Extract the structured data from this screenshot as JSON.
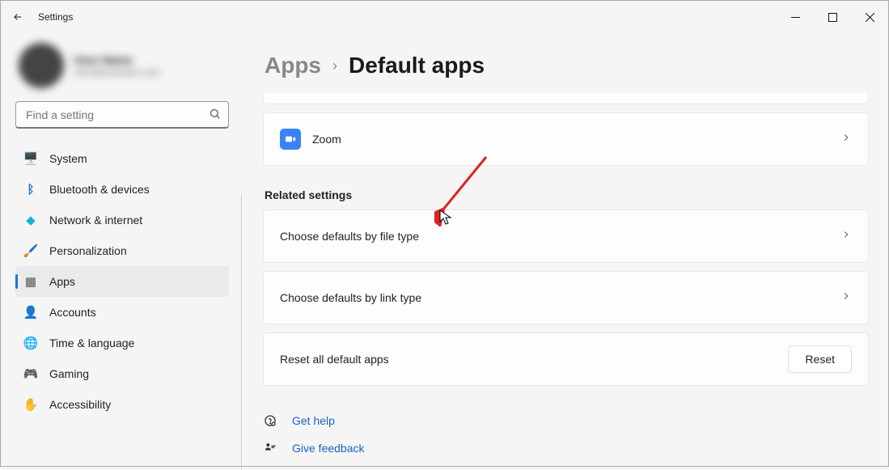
{
  "window": {
    "title": "Settings"
  },
  "search": {
    "placeholder": "Find a setting"
  },
  "profile": {
    "name": "User Name",
    "email": "user@example.com"
  },
  "nav": {
    "items": [
      {
        "icon": "🖥️",
        "label": "System"
      },
      {
        "icon": "B",
        "label": "Bluetooth & devices",
        "iconColor": "#1976d2"
      },
      {
        "icon": "◆",
        "label": "Network & internet",
        "iconColor": "#1bb1d4"
      },
      {
        "icon": "🖌️",
        "label": "Personalization"
      },
      {
        "icon": "▦",
        "label": "Apps",
        "selected": true
      },
      {
        "icon": "👤",
        "label": "Accounts",
        "iconColor": "#2fae4f"
      },
      {
        "icon": "🌐",
        "label": "Time & language"
      },
      {
        "icon": "🎮",
        "label": "Gaming"
      },
      {
        "icon": "✋",
        "label": "Accessibility"
      }
    ]
  },
  "breadcrumb": {
    "parent": "Apps",
    "current": "Default apps"
  },
  "apps": {
    "zoom": {
      "label": "Zoom"
    }
  },
  "related": {
    "header": "Related settings",
    "filetype": {
      "label": "Choose defaults by file type"
    },
    "linktype": {
      "label": "Choose defaults by link type"
    },
    "reset": {
      "label": "Reset all default apps",
      "button": "Reset"
    }
  },
  "links": {
    "help": "Get help",
    "feedback": "Give feedback"
  }
}
